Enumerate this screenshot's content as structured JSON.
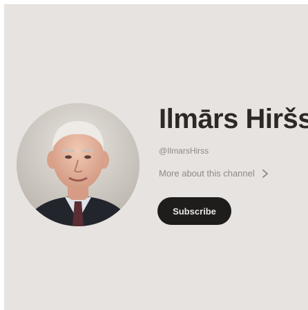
{
  "channel": {
    "name": "Ilmārs Hiršs",
    "handle": "@IlmarsHirss",
    "more_about_label": "More about this channel",
    "subscribe_label": "Subscribe",
    "avatar_icon": "channel-avatar-photo",
    "chevron_icon": "chevron-right-icon"
  },
  "colors": {
    "background": "#e6e3e0",
    "title": "#2b2826",
    "muted_text": "#8f8a86",
    "subscribe_bg": "#1f1d1c",
    "subscribe_text": "#e9e6e3"
  }
}
